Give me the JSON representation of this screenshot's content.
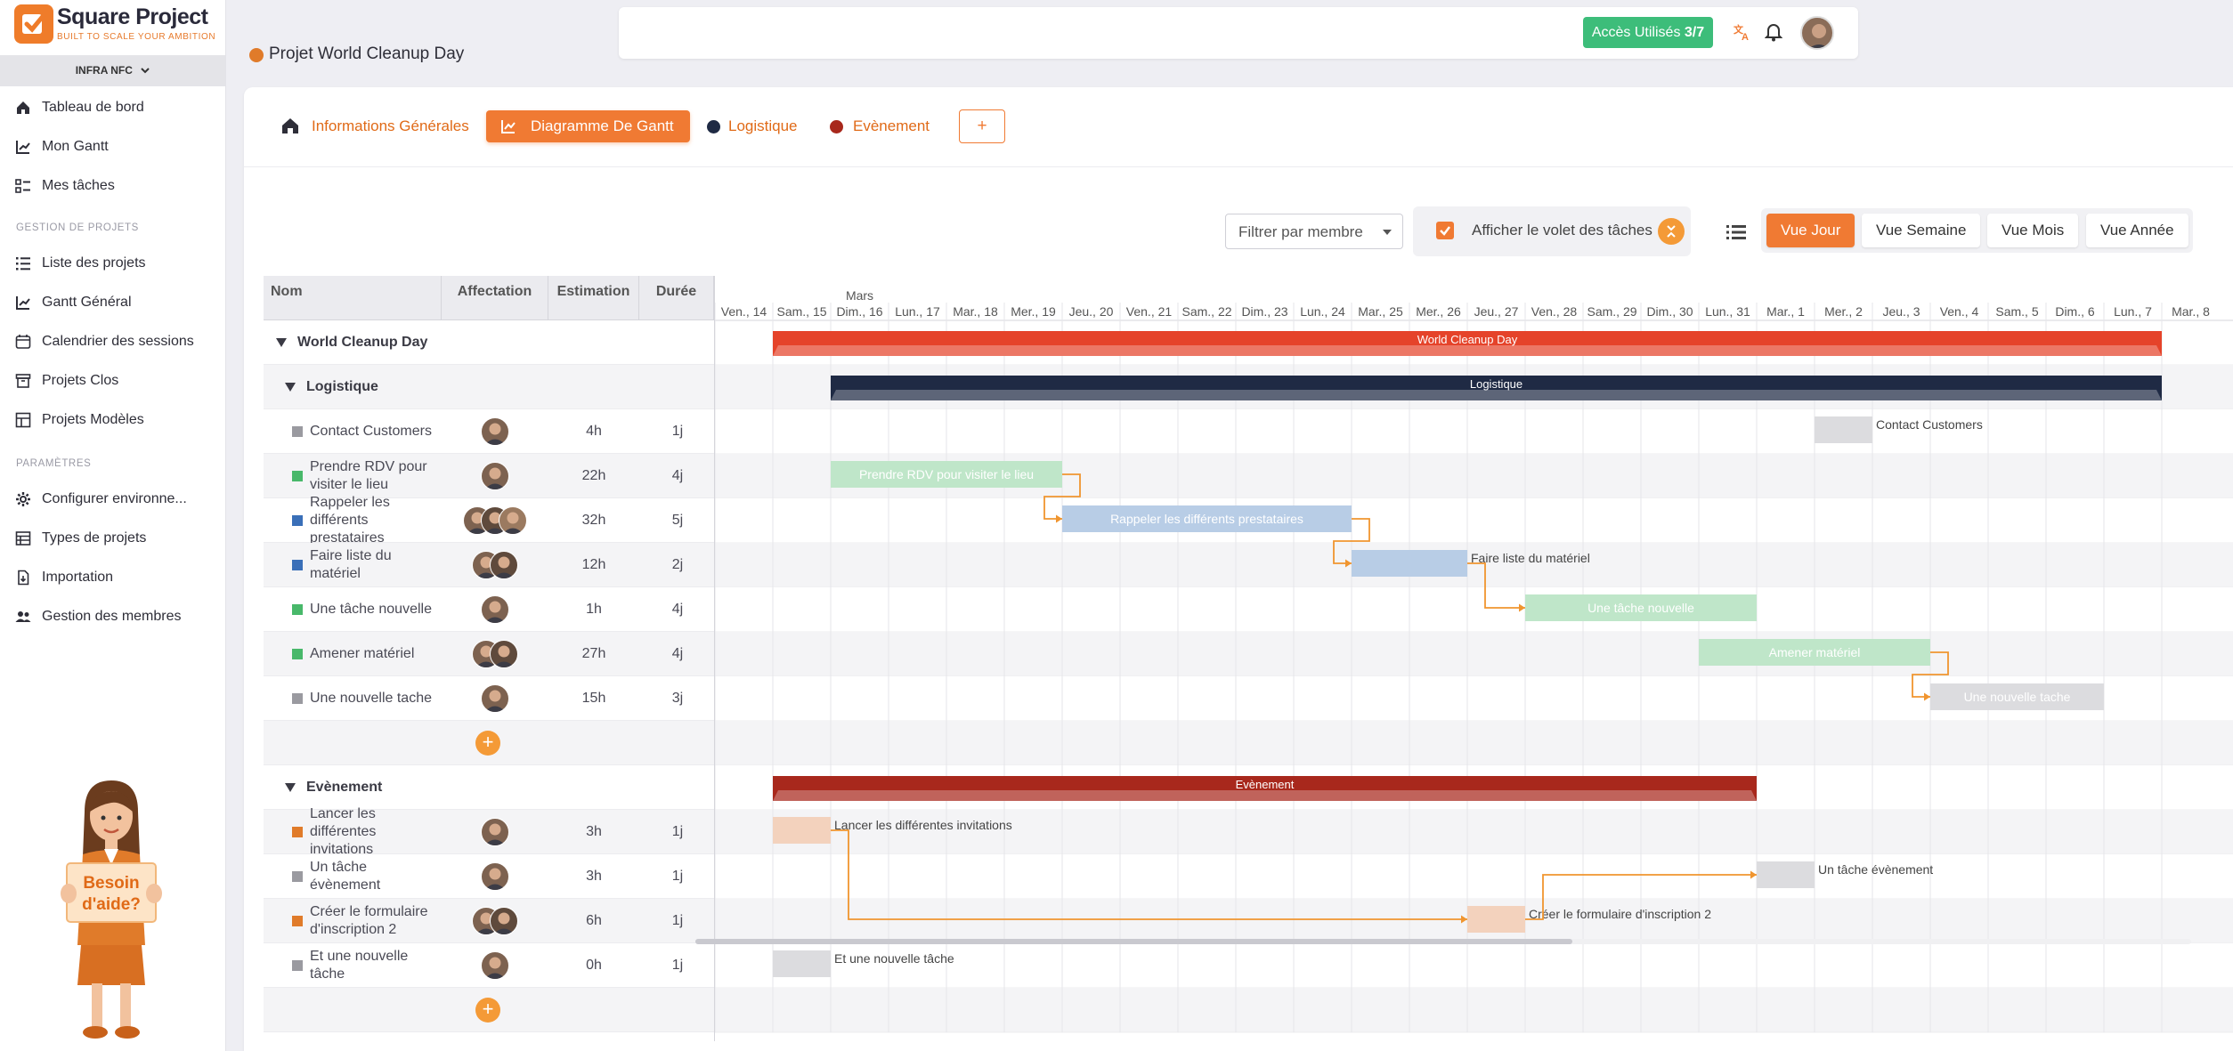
{
  "app": {
    "name": "Square Project",
    "tagline": "BUILT TO SCALE YOUR AMBITION",
    "org": "INFRA NFC"
  },
  "sidebar": {
    "main": [
      {
        "label": "Tableau de bord",
        "icon": "home-icon"
      },
      {
        "label": "Mon Gantt",
        "icon": "gantt-chart-icon"
      },
      {
        "label": "Mes tâches",
        "icon": "task-list-icon"
      }
    ],
    "section_projects": "GESTION DE PROJETS",
    "projects": [
      {
        "label": "Liste des projets",
        "icon": "list-icon"
      },
      {
        "label": "Gantt Général",
        "icon": "gantt-chart-icon"
      },
      {
        "label": "Calendrier des sessions",
        "icon": "calendar-icon"
      },
      {
        "label": "Projets Clos",
        "icon": "archive-icon"
      },
      {
        "label": "Projets Modèles",
        "icon": "template-icon"
      }
    ],
    "section_settings": "PARAMÈTRES",
    "settings": [
      {
        "label": "Configurer environne...",
        "icon": "gear-icon"
      },
      {
        "label": "Types de projets",
        "icon": "table-icon"
      },
      {
        "label": "Importation",
        "icon": "import-icon"
      },
      {
        "label": "Gestion des membres",
        "icon": "users-icon"
      }
    ],
    "helper_text": "Besoin d'aide?"
  },
  "topbar": {
    "project_title": "Projet World Cleanup Day",
    "access_label": "Accès Utilisés",
    "access_count": "3/7",
    "colors": {
      "brand": "#f07a33",
      "access": "#3dbd7a"
    }
  },
  "tabs": [
    {
      "label": "Informations Générales",
      "active": false
    },
    {
      "label": "Diagramme De Gantt",
      "active": true
    },
    {
      "label": "Logistique",
      "dot": "#1f2a44",
      "active": false
    },
    {
      "label": "Evènement",
      "dot": "#a8281c",
      "active": false
    }
  ],
  "tab_add_label": "+",
  "controls": {
    "filter_placeholder": "Filtrer par membre",
    "show_tasks_panel": "Afficher le volet des tâches",
    "show_tasks_checked": true,
    "views": [
      "Vue Jour",
      "Vue Semaine",
      "Vue Mois",
      "Vue Année"
    ],
    "active_view": "Vue Jour"
  },
  "grid": {
    "columns": [
      "Nom",
      "Affectation",
      "Estimation",
      "Durée"
    ],
    "add_label": "+"
  },
  "chart_data": {
    "type": "gantt",
    "month_label": "Mars",
    "days": [
      "Ven., 14",
      "Sam., 15",
      "Dim., 16",
      "Lun., 17",
      "Mar., 18",
      "Mer., 19",
      "Jeu., 20",
      "Ven., 21",
      "Sam., 22",
      "Dim., 23",
      "Lun., 24",
      "Mar., 25",
      "Mer., 26",
      "Jeu., 27",
      "Ven., 28",
      "Sam., 29",
      "Dim., 30",
      "Lun., 31",
      "Mar., 1",
      "Mer., 2",
      "Jeu., 3",
      "Ven., 4",
      "Sam., 5",
      "Dim., 6",
      "Lun., 7",
      "Mar., 8"
    ],
    "rows": [
      {
        "kind": "project",
        "name": "World Cleanup Day",
        "start": "Sam., 15",
        "days": 24,
        "color": "#e5432a"
      },
      {
        "kind": "group",
        "name": "Logistique",
        "start": "Dim., 16",
        "days": 23,
        "color": "#1f2a44"
      },
      {
        "kind": "task",
        "name": "Contact Customers",
        "square": "#9a9aa0",
        "assignees": 1,
        "estimate": "4h",
        "duration": "1j",
        "start": "Mer., 2",
        "days": 1,
        "color": "#dcdcdf",
        "label_inside": false
      },
      {
        "kind": "task",
        "name": "Prendre RDV pour visiter le lieu",
        "square": "#48b86a",
        "assignees": 1,
        "estimate": "22h",
        "duration": "4j",
        "start": "Dim., 16",
        "days": 4,
        "color": "#bfe6c9",
        "label_inside": true
      },
      {
        "kind": "task",
        "name": "Rappeler les différents prestataires",
        "square": "#3a6fb8",
        "assignees": 3,
        "estimate": "32h",
        "duration": "5j",
        "start": "Jeu., 20",
        "days": 5,
        "color": "#b8cde6",
        "label_inside": true
      },
      {
        "kind": "task",
        "name": "Faire liste du matériel",
        "square": "#3a6fb8",
        "assignees": 2,
        "estimate": "12h",
        "duration": "2j",
        "start": "Mar., 25",
        "days": 2,
        "color": "#b8cde6",
        "label_inside": false
      },
      {
        "kind": "task",
        "name": "Une tâche nouvelle",
        "square": "#48b86a",
        "assignees": 1,
        "estimate": "1h",
        "duration": "4j",
        "start": "Ven., 28",
        "days": 4,
        "color": "#bfe6c9",
        "label_inside": true
      },
      {
        "kind": "task",
        "name": "Amener matériel",
        "square": "#48b86a",
        "assignees": 2,
        "estimate": "27h",
        "duration": "4j",
        "start": "Lun., 31",
        "days": 4,
        "color": "#bfe6c9",
        "label_inside": true
      },
      {
        "kind": "task",
        "name": "Une nouvelle tache",
        "square": "#9a9aa0",
        "assignees": 1,
        "estimate": "15h",
        "duration": "3j",
        "start": "Ven., 4",
        "days": 3,
        "color": "#dcdcdf",
        "label_inside": true
      },
      {
        "kind": "add"
      },
      {
        "kind": "group",
        "name": "Evènement",
        "start": "Sam., 15",
        "days": 17,
        "color": "#a8281c"
      },
      {
        "kind": "task",
        "name": "Lancer les différentes invitations",
        "square": "#e07b2a",
        "assignees": 1,
        "estimate": "3h",
        "duration": "1j",
        "start": "Sam., 15",
        "days": 1,
        "color": "#f3d2bd",
        "label_inside": false
      },
      {
        "kind": "task",
        "name": "Un tâche évènement",
        "square": "#9a9aa0",
        "assignees": 1,
        "estimate": "3h",
        "duration": "1j",
        "start": "Mar., 1",
        "days": 1,
        "color": "#dcdcdf",
        "label_inside": false
      },
      {
        "kind": "task",
        "name": "Créer le formulaire d'inscription 2",
        "square": "#e07b2a",
        "assignees": 2,
        "estimate": "6h",
        "duration": "1j",
        "start": "Jeu., 27",
        "days": 1,
        "color": "#f3d2bd",
        "label_inside": false
      },
      {
        "kind": "task",
        "name": "Et une nouvelle tâche",
        "square": "#9a9aa0",
        "assignees": 1,
        "estimate": "0h",
        "duration": "1j",
        "start": "Sam., 15",
        "days": 1,
        "color": "#dcdcdf",
        "label_inside": false
      },
      {
        "kind": "add"
      }
    ],
    "dependencies": [
      [
        "Prendre RDV pour visiter le lieu",
        "Rappeler les différents prestataires"
      ],
      [
        "Rappeler les différents prestataires",
        "Faire liste du matériel"
      ],
      [
        "Faire liste du matériel",
        "Une tâche nouvelle"
      ],
      [
        "Amener matériel",
        "Une nouvelle tache"
      ],
      [
        "Lancer les différentes invitations",
        "Créer le formulaire d'inscription 2"
      ],
      [
        "Créer le formulaire d'inscription 2",
        "Un tâche évènement"
      ]
    ],
    "dependency_color": "#f0952f"
  }
}
